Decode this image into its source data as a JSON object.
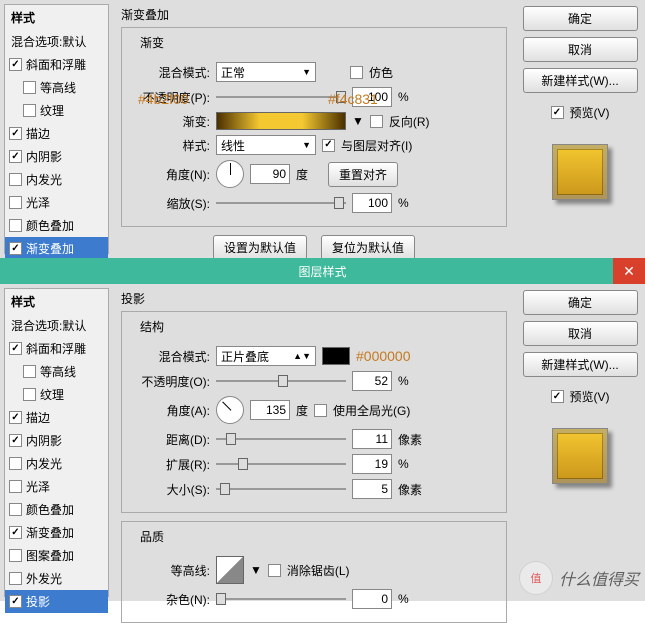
{
  "panel1": {
    "sidebar": {
      "title": "样式",
      "subtitle": "混合选项:默认",
      "items": [
        {
          "label": "斜面和浮雕",
          "checked": true,
          "indent": false
        },
        {
          "label": "等高线",
          "checked": false,
          "indent": true
        },
        {
          "label": "纹理",
          "checked": false,
          "indent": true
        },
        {
          "label": "描边",
          "checked": true,
          "indent": false
        },
        {
          "label": "内阴影",
          "checked": true,
          "indent": false
        },
        {
          "label": "内发光",
          "checked": false,
          "indent": false
        },
        {
          "label": "光泽",
          "checked": false,
          "indent": false
        },
        {
          "label": "颜色叠加",
          "checked": false,
          "indent": false
        },
        {
          "label": "渐变叠加",
          "checked": true,
          "indent": false,
          "selected": true
        }
      ]
    },
    "title": "渐变叠加",
    "group_title": "渐变",
    "blend": {
      "label": "混合模式:",
      "value": "正常",
      "dither": "仿色"
    },
    "opacity": {
      "label": "不透明度(P):",
      "value": "100",
      "unit": "%"
    },
    "gradient": {
      "label": "渐变:",
      "reverse": "反向(R)",
      "c1": "#4b2f00",
      "c2": "#f4c831"
    },
    "style": {
      "label": "样式:",
      "value": "线性",
      "align": "与图层对齐(I)"
    },
    "angle": {
      "label": "角度(N):",
      "value": "90",
      "unit": "度",
      "reset": "重置对齐"
    },
    "scale": {
      "label": "缩放(S):",
      "value": "100",
      "unit": "%"
    },
    "btn_default": "设置为默认值",
    "btn_reset": "复位为默认值",
    "buttons": {
      "ok": "确定",
      "cancel": "取消",
      "new": "新建样式(W)...",
      "preview": "预览(V)"
    }
  },
  "titlebar": "图层样式",
  "panel2": {
    "sidebar": {
      "title": "样式",
      "subtitle": "混合选项:默认",
      "items": [
        {
          "label": "斜面和浮雕",
          "checked": true,
          "indent": false
        },
        {
          "label": "等高线",
          "checked": false,
          "indent": true
        },
        {
          "label": "纹理",
          "checked": false,
          "indent": true
        },
        {
          "label": "描边",
          "checked": true,
          "indent": false
        },
        {
          "label": "内阴影",
          "checked": true,
          "indent": false
        },
        {
          "label": "内发光",
          "checked": false,
          "indent": false
        },
        {
          "label": "光泽",
          "checked": false,
          "indent": false
        },
        {
          "label": "颜色叠加",
          "checked": false,
          "indent": false
        },
        {
          "label": "渐变叠加",
          "checked": true,
          "indent": false
        },
        {
          "label": "图案叠加",
          "checked": false,
          "indent": false
        },
        {
          "label": "外发光",
          "checked": false,
          "indent": false
        },
        {
          "label": "投影",
          "checked": true,
          "indent": false,
          "selected": true
        }
      ]
    },
    "title": "投影",
    "group1_title": "结构",
    "blend": {
      "label": "混合模式:",
      "value": "正片叠底",
      "color": "#000000",
      "annot": "#000000"
    },
    "opacity": {
      "label": "不透明度(O):",
      "value": "52",
      "unit": "%"
    },
    "angle": {
      "label": "角度(A):",
      "value": "135",
      "unit": "度",
      "global": "使用全局光(G)"
    },
    "distance": {
      "label": "距离(D):",
      "value": "11",
      "unit": "像素"
    },
    "spread": {
      "label": "扩展(R):",
      "value": "19",
      "unit": "%"
    },
    "size": {
      "label": "大小(S):",
      "value": "5",
      "unit": "像素"
    },
    "group2_title": "品质",
    "contour": {
      "label": "等高线:",
      "anti": "消除锯齿(L)"
    },
    "noise": {
      "label": "杂色(N):",
      "value": "0",
      "unit": "%"
    },
    "buttons": {
      "ok": "确定",
      "cancel": "取消",
      "new": "新建样式(W)...",
      "preview": "预览(V)"
    }
  },
  "watermark": {
    "badge": "值",
    "text": "什么值得买"
  }
}
